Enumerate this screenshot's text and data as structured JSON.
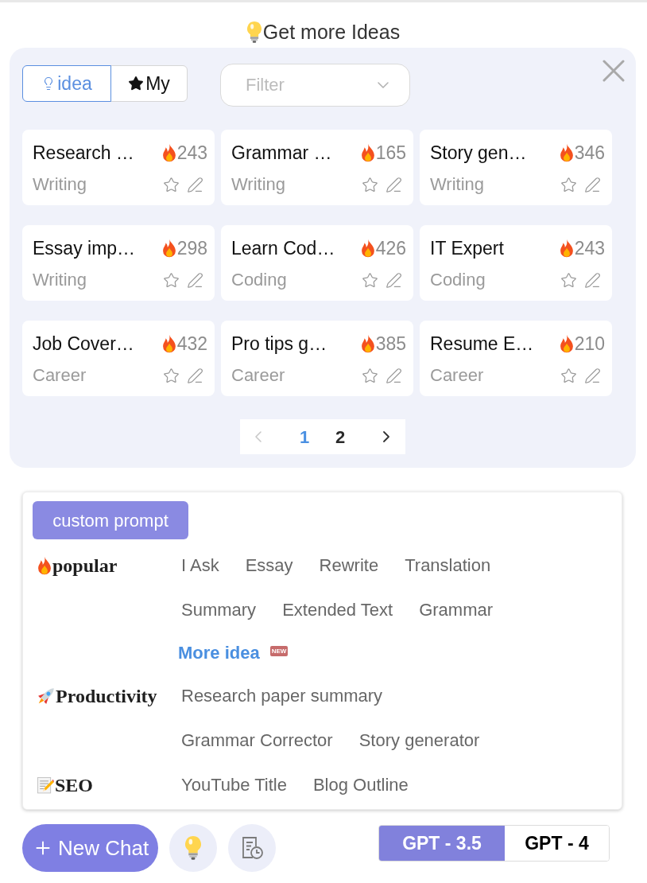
{
  "header": {
    "title": "Get more Ideas"
  },
  "ideas_panel": {
    "tabs": [
      {
        "kind": "idea",
        "label": "idea",
        "selected": true
      },
      {
        "kind": "my",
        "label": "My",
        "selected": false
      }
    ],
    "filter": {
      "placeholder": "Filter"
    },
    "cards": [
      {
        "title": "Research …",
        "count": "243",
        "category": "Writing",
        "starred": false
      },
      {
        "title": "Grammar …",
        "count": "165",
        "category": "Writing",
        "starred": false
      },
      {
        "title": "Story gen…",
        "count": "346",
        "category": "Writing",
        "starred": false
      },
      {
        "title": "Essay imp…",
        "count": "298",
        "category": "Writing",
        "starred": false
      },
      {
        "title": "Learn Cod…",
        "count": "426",
        "category": "Coding",
        "starred": false
      },
      {
        "title": "IT Expert",
        "count": "243",
        "category": "Coding",
        "starred": false
      },
      {
        "title": "Job Cover…",
        "count": "432",
        "category": "Career",
        "starred": false
      },
      {
        "title": "Pro tips g…",
        "count": "385",
        "category": "Career",
        "starred": false
      },
      {
        "title": "Resume E…",
        "count": "210",
        "category": "Career",
        "starred": false
      }
    ],
    "pagination": {
      "prev": {
        "disabled": true
      },
      "pages": [
        {
          "label": "1",
          "selected": true
        },
        {
          "label": "2",
          "selected": false
        }
      ],
      "next": {
        "disabled": false
      }
    }
  },
  "prompt_panel": {
    "button": "custom prompt",
    "groups": [
      {
        "kind": "popular",
        "label": "popular",
        "lines": [
          [
            "I Ask",
            "Essay",
            "Rewrite",
            "Translation"
          ],
          [
            "Summary",
            "Extended Text",
            "Grammar"
          ]
        ],
        "more": {
          "label": "More idea",
          "badge": "NEW"
        }
      },
      {
        "kind": "productivity",
        "label": "Productivity",
        "lines": [
          [
            "Research paper summary"
          ],
          [
            "Grammar Corrector",
            "Story generator"
          ]
        ]
      },
      {
        "kind": "seo",
        "label": "SEO",
        "lines": [
          [
            "YouTube Title",
            "Blog Outline"
          ]
        ]
      }
    ]
  },
  "footer": {
    "new_chat": "New Chat",
    "models": [
      {
        "label": "GPT - 3.5",
        "selected": true
      },
      {
        "label": "GPT - 4",
        "selected": false
      }
    ]
  }
}
